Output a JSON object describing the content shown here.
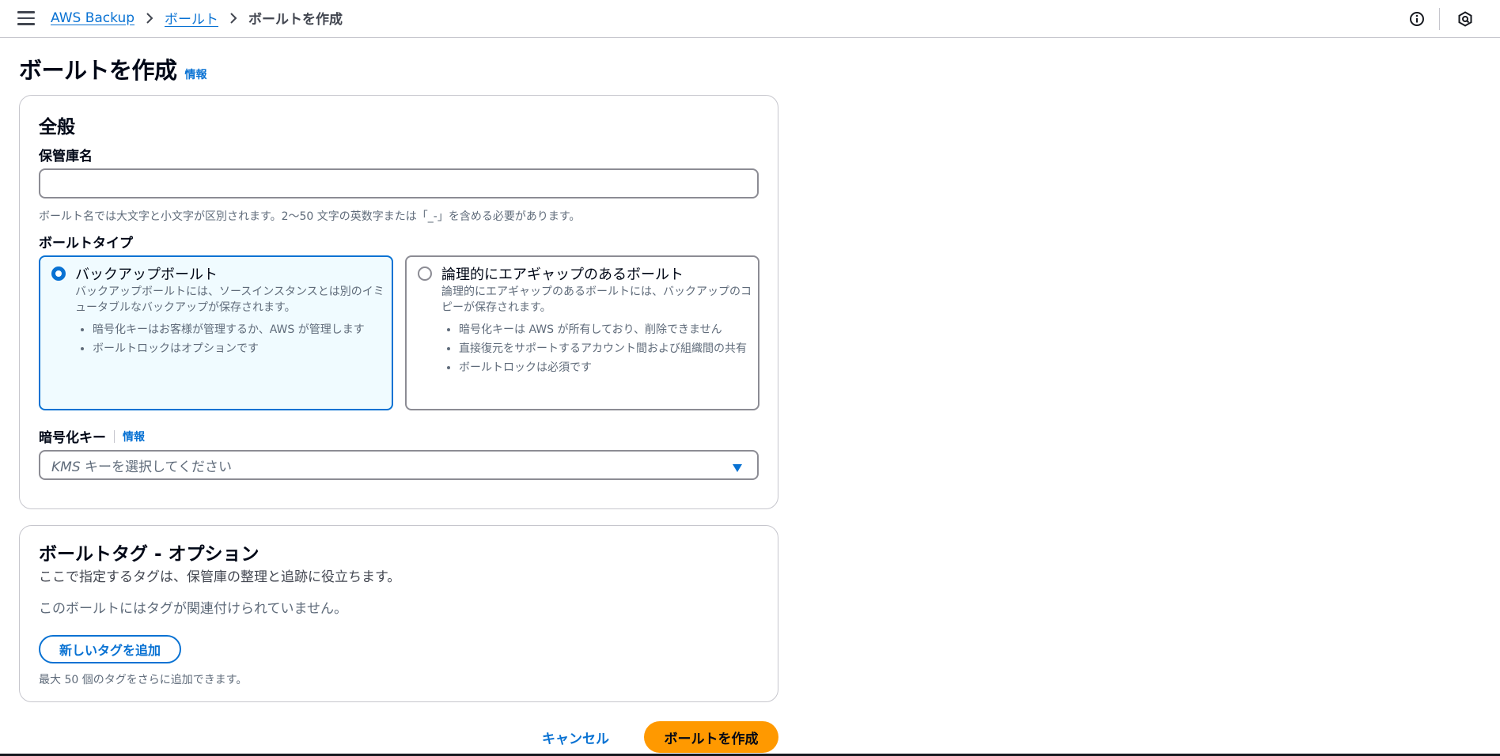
{
  "breadcrumb": {
    "items": [
      "AWS Backup",
      "ボールト"
    ],
    "current": "ボールトを作成"
  },
  "page": {
    "title": "ボールトを作成",
    "info_label": "情報"
  },
  "general": {
    "heading": "全般",
    "vault_name": {
      "label": "保管庫名",
      "value": "",
      "placeholder": "",
      "hint": "ボールト名では大文字と小文字が区別されます。2〜50 文字の英数字または「_-」を含める必要があります。"
    },
    "vault_type": {
      "label": "ボールトタイプ",
      "options": [
        {
          "title": "バックアップボールト",
          "description": "バックアップボールトには、ソースインスタンスとは別のイミュータブルなバックアップが保存されます。",
          "bullets": [
            "暗号化キーはお客様が管理するか、AWS が管理します",
            "ボールトロックはオプションです"
          ],
          "selected": true
        },
        {
          "title": "論理的にエアギャップのあるボールト",
          "description": "論理的にエアギャップのあるボールトには、バックアップのコピーが保存されます。",
          "bullets": [
            "暗号化キーは AWS が所有しており、削除できません",
            "直接復元をサポートするアカウント間および組織間の共有",
            "ボールトロックは必須です"
          ],
          "selected": false
        }
      ]
    },
    "encryption": {
      "label": "暗号化キー",
      "info_label": "情報",
      "placeholder_prefix": "KMS",
      "placeholder_rest": " キーを選択してください"
    }
  },
  "tags": {
    "heading": "ボールトタグ - オプション",
    "description": "ここで指定するタグは、保管庫の整理と追跡に役立ちます。",
    "empty_text": "このボールトにはタグが関連付けられていません。",
    "add_button": "新しいタグを追加",
    "limit_hint": "最大 50 個のタグをさらに追加できます。"
  },
  "actions": {
    "cancel": "キャンセル",
    "create": "ボールトを作成"
  },
  "colors": {
    "link": "#0972d3",
    "primary_button": "#ff9900",
    "selected_card_bg": "#f0fbff",
    "border": "#8c8c94"
  }
}
